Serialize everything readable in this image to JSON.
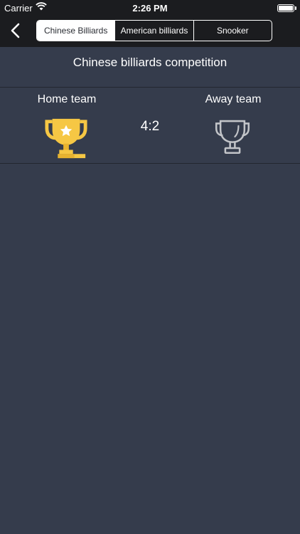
{
  "status": {
    "carrier": "Carrier",
    "time": "2:26 PM"
  },
  "tabs": [
    {
      "label": "Chinese Billiards",
      "active": true
    },
    {
      "label": "American billiards",
      "active": false
    },
    {
      "label": "Snooker",
      "active": false
    }
  ],
  "page": {
    "title": "Chinese billiards competition"
  },
  "match": {
    "home_label": "Home team",
    "away_label": "Away team",
    "score": "4:2"
  },
  "icons": {
    "back": "chevron-left-icon",
    "home_trophy": "trophy-gold-icon",
    "away_trophy": "trophy-outline-icon"
  },
  "colors": {
    "background": "#353c4c",
    "nav": "#1b1c1f",
    "gold": "#f6c744",
    "silver": "#c2c4c8"
  }
}
